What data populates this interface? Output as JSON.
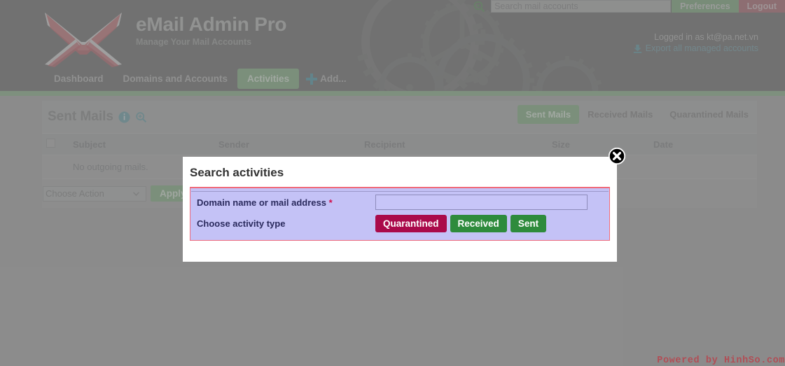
{
  "header": {
    "app_title": "eMail Admin Pro",
    "app_subtitle": "Manage Your Mail Accounts",
    "logo_icon": "envelope-x-logo",
    "search": {
      "placeholder": "Search mail accounts",
      "value": "",
      "icon": "magnifier-plus-icon"
    },
    "preferences_label": "Preferences",
    "logout_label": "Logout",
    "logged_in_as": "Logged in as kt@pa.net.vn",
    "export_label": "Export all managed accounts",
    "export_icon": "download-icon",
    "nav": [
      {
        "label": "Dashboard",
        "active": false
      },
      {
        "label": "Domains and Accounts",
        "active": false
      },
      {
        "label": "Activities",
        "active": true
      }
    ],
    "add_label": "Add...",
    "add_icon": "plus-icon"
  },
  "panel": {
    "title": "Sent Mails",
    "info_icon": "info-circle-icon",
    "search_icon": "magnifier-plus-icon",
    "tabs": [
      {
        "label": "Sent Mails",
        "active": true
      },
      {
        "label": "Received Mails",
        "active": false
      },
      {
        "label": "Quarantined Mails",
        "active": false
      }
    ],
    "table": {
      "columns": [
        "",
        "Subject",
        "Sender",
        "Recipient",
        "Size",
        "Date"
      ],
      "empty_message": "No outgoing mails.",
      "rows": []
    },
    "actions": {
      "select_value": "Choose Action",
      "apply_label": "Apply",
      "chevron_icon": "chevron-down-icon"
    }
  },
  "modal": {
    "title": "Search activities",
    "close_icon": "close-circle-icon",
    "domain_label": "Domain name or mail address",
    "required_marker": "*",
    "domain_value": "",
    "domain_placeholder": "",
    "activity_label": "Choose activity type",
    "activity_buttons": [
      {
        "label": "Quarantined",
        "color": "#aa0a4a"
      },
      {
        "label": "Received",
        "color": "#2e8b3c"
      },
      {
        "label": "Sent",
        "color": "#2e8b3c"
      }
    ]
  },
  "footer": {
    "powered_by": "Powered by HinhSo.com"
  },
  "colors": {
    "header_bg": "#5f6160",
    "green_accent": "#7da47d",
    "page_bg": "#9a9a9a",
    "teal_icon": "#5a909c",
    "modal_form_bg": "#c4c2f6",
    "modal_form_border": "#f06a7a",
    "footer_red": "#ee1122"
  }
}
